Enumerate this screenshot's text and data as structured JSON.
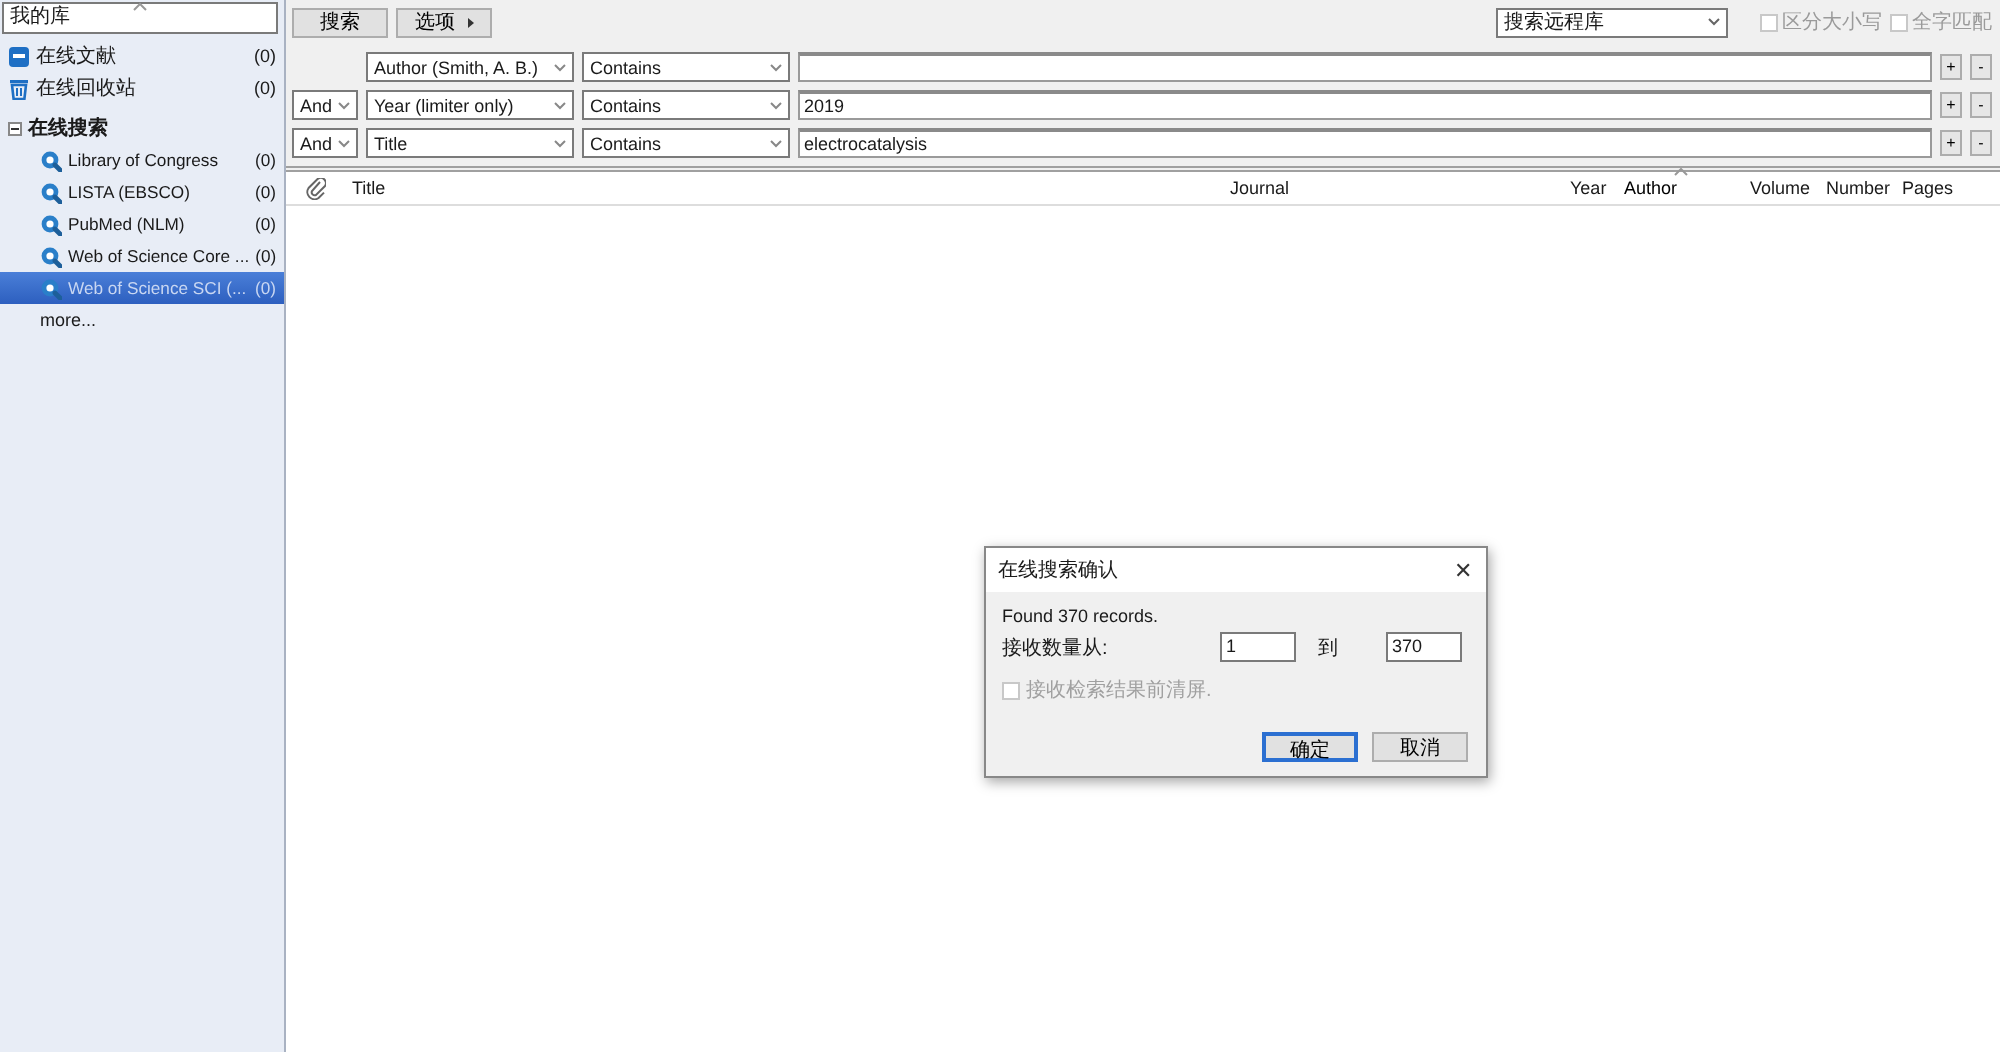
{
  "library_field": {
    "value": "我的库"
  },
  "library_items": [
    {
      "kind": "online",
      "label": "在线文献",
      "count": "(0)"
    },
    {
      "kind": "trash",
      "label": "在线回收站",
      "count": "(0)"
    }
  ],
  "online_search": {
    "label": "在线搜索",
    "expanded": true,
    "items": [
      {
        "label": "Library of Congress",
        "count": "(0)",
        "selected": false
      },
      {
        "label": "LISTA (EBSCO)",
        "count": "(0)",
        "selected": false
      },
      {
        "label": "PubMed (NLM)",
        "count": "(0)",
        "selected": false
      },
      {
        "label": "Web of Science Core ...",
        "count": "(0)",
        "selected": false
      },
      {
        "label": "Web of Science SCI (...",
        "count": "(0)",
        "selected": true
      }
    ],
    "more": "more..."
  },
  "toolbar": {
    "buttons": [
      {
        "label": "搜索",
        "menu": false
      },
      {
        "label": "选项",
        "menu": true
      }
    ],
    "source": "搜索远程库",
    "options": [
      {
        "label": "区分大小写",
        "checked": false,
        "disabled": true
      },
      {
        "label": "全字匹配",
        "checked": false,
        "disabled": true
      }
    ]
  },
  "search_rows": [
    {
      "field": "Author (Smith, A. B.)",
      "operator": "Contains",
      "value": ""
    },
    {
      "bool": "And",
      "field": "Year (limiter only)",
      "operator": "Contains",
      "value": "2019"
    },
    {
      "bool": "And",
      "field": "Title",
      "operator": "Contains",
      "value": "electrocatalysis"
    }
  ],
  "row_buttons": [
    "+",
    "-"
  ],
  "table": {
    "columns": [
      {
        "kind": "attachment"
      },
      {
        "label": "Title"
      },
      {
        "label": "Journal"
      },
      {
        "label": "Year"
      },
      {
        "label": "Author",
        "sorted": true
      },
      {
        "label": "Volume"
      },
      {
        "label": "Number"
      },
      {
        "label": "Pages"
      }
    ]
  },
  "dialog": {
    "title": "在线搜索确认",
    "close": "✕",
    "message": "Found 370 records.",
    "from_label": "接收数量从:",
    "from_value": "1",
    "to_label": "到",
    "to_value": "370",
    "checkbox": {
      "label": "接收检索结果前清屏.",
      "checked": false,
      "disabled": true
    },
    "buttons": [
      {
        "label": "确定",
        "default": true
      },
      {
        "label": "取消",
        "default": false
      }
    ]
  }
}
